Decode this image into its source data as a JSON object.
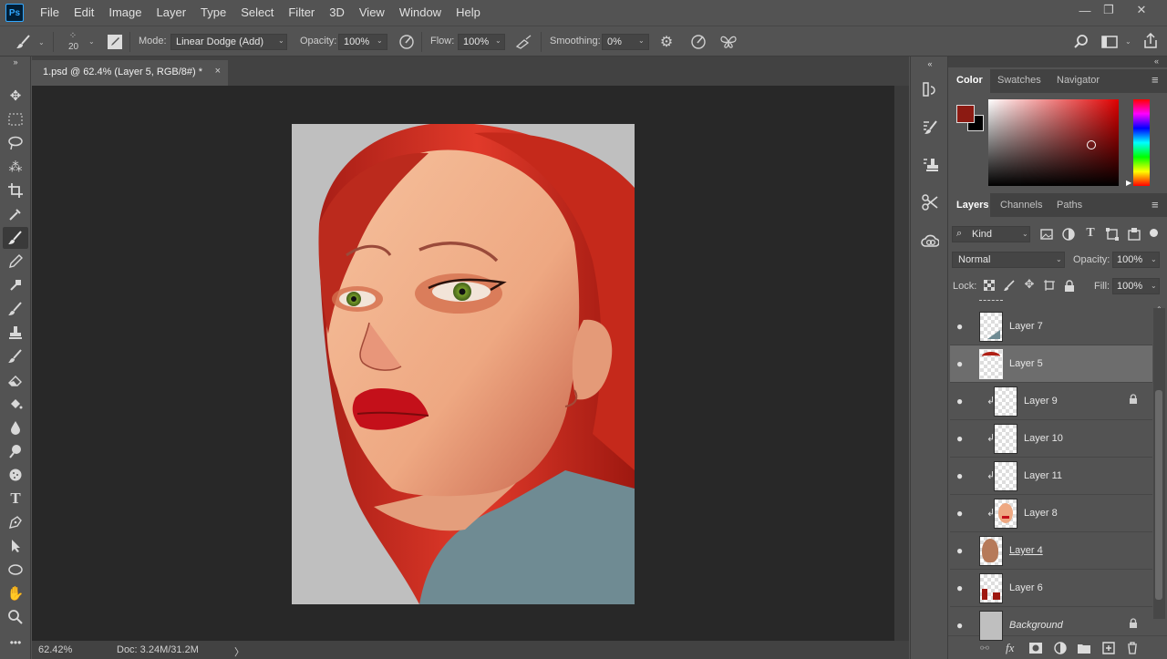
{
  "app": {
    "logo": "Ps"
  },
  "menu": [
    "File",
    "Edit",
    "Image",
    "Layer",
    "Type",
    "Select",
    "Filter",
    "3D",
    "View",
    "Window",
    "Help"
  ],
  "window_controls": {
    "minimize": "—",
    "restore": "❐",
    "close": "✕"
  },
  "options": {
    "brush_size": "20",
    "mode_label": "Mode:",
    "mode_value": "Linear Dodge (Add)",
    "opacity_label": "Opacity:",
    "opacity_value": "100%",
    "flow_label": "Flow:",
    "flow_value": "100%",
    "smoothing_label": "Smoothing:",
    "smoothing_value": "0%"
  },
  "document": {
    "tab_title": "1.psd @ 62.4% (Layer 5, RGB/8#) *",
    "close": "×"
  },
  "status": {
    "zoom": "62.42%",
    "doc_info": "Doc: 3.24M/31.2M",
    "arrow": "〉"
  },
  "color_panel": {
    "tabs": [
      "Color",
      "Swatches",
      "Navigator"
    ],
    "foreground": "#8c1a12",
    "background": "#000000",
    "hue_base": "#e00000"
  },
  "layers_panel": {
    "tabs": [
      "Layers",
      "Channels",
      "Paths"
    ],
    "kind_label": "Kind",
    "blend_mode": "Normal",
    "opacity_label": "Opacity:",
    "opacity_value": "100%",
    "lock_label": "Lock:",
    "fill_label": "Fill:",
    "fill_value": "100%",
    "layers": [
      {
        "name": "Layer 7",
        "clipped": false,
        "locked": false,
        "selected": false
      },
      {
        "name": "Layer 5",
        "clipped": false,
        "locked": false,
        "selected": true
      },
      {
        "name": "Layer 9",
        "clipped": true,
        "locked": true,
        "selected": false
      },
      {
        "name": "Layer 10",
        "clipped": true,
        "locked": false,
        "selected": false
      },
      {
        "name": "Layer 11",
        "clipped": true,
        "locked": false,
        "selected": false
      },
      {
        "name": "Layer 8",
        "clipped": true,
        "locked": false,
        "selected": false
      },
      {
        "name": "Layer 4",
        "clipped": false,
        "locked": false,
        "selected": false
      },
      {
        "name": "Layer 6",
        "clipped": false,
        "locked": false,
        "selected": false
      },
      {
        "name": "Background",
        "clipped": false,
        "locked": true,
        "selected": false
      }
    ],
    "footer_fx": "fx"
  },
  "colors": {
    "skin": "#eea882",
    "hair": "#c8281c",
    "sweater": "#6f8b93",
    "canvas_bg": "#bfbfbf",
    "iris": "#7aa12a",
    "lips": "#c4101a"
  }
}
